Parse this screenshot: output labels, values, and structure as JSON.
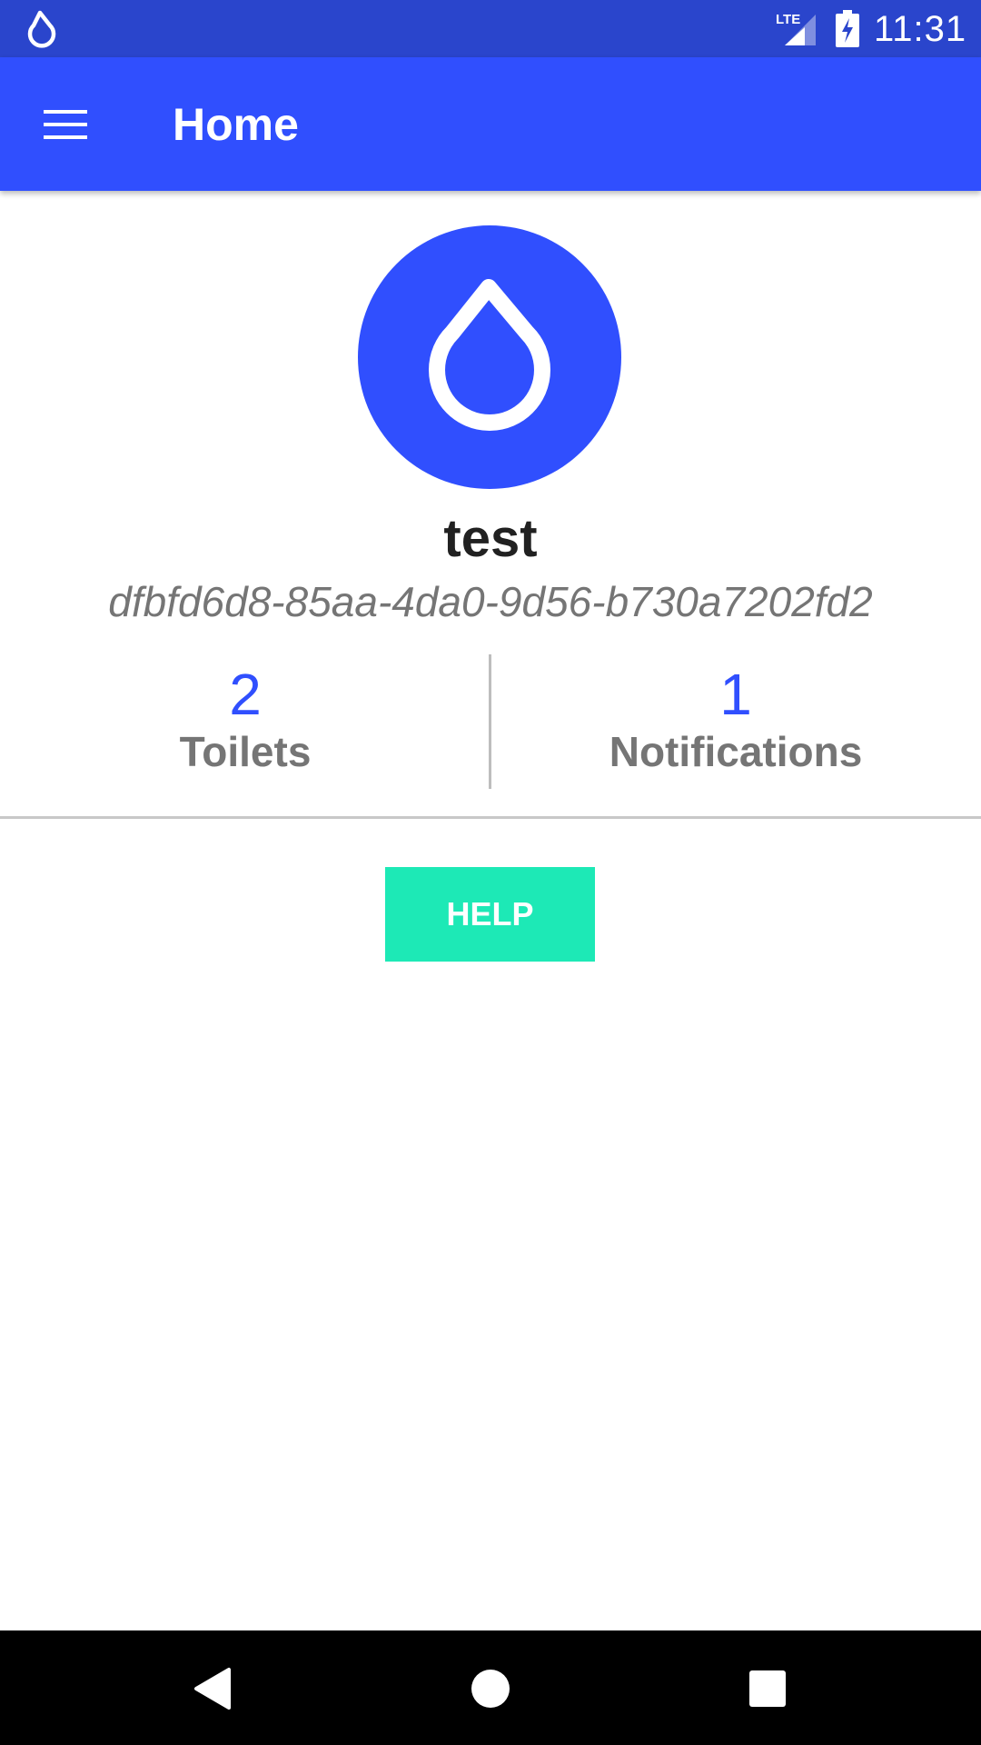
{
  "status_bar": {
    "time": "11:31",
    "network": "LTE",
    "icons": [
      "app-drop-icon",
      "signal-icon",
      "battery-charging-icon"
    ]
  },
  "app_bar": {
    "title": "Home",
    "menu_icon": "hamburger-menu-icon"
  },
  "profile": {
    "avatar_icon": "water-drop-icon",
    "name": "test",
    "id": "dfbfd6d8-85aa-4da0-9d56-b730a7202fd2"
  },
  "stats": {
    "toilets": {
      "count": "2",
      "label": "Toilets"
    },
    "notifications": {
      "count": "1",
      "label": "Notifications"
    }
  },
  "help_button": {
    "label": "HELP"
  },
  "nav_bar": {
    "icons": [
      "back-icon",
      "home-icon",
      "recents-icon"
    ]
  },
  "colors": {
    "status_bar": "#2a45cc",
    "primary": "#304ffe",
    "accent": "#1de9b6",
    "text_secondary": "#757575",
    "text_primary": "#212121"
  }
}
